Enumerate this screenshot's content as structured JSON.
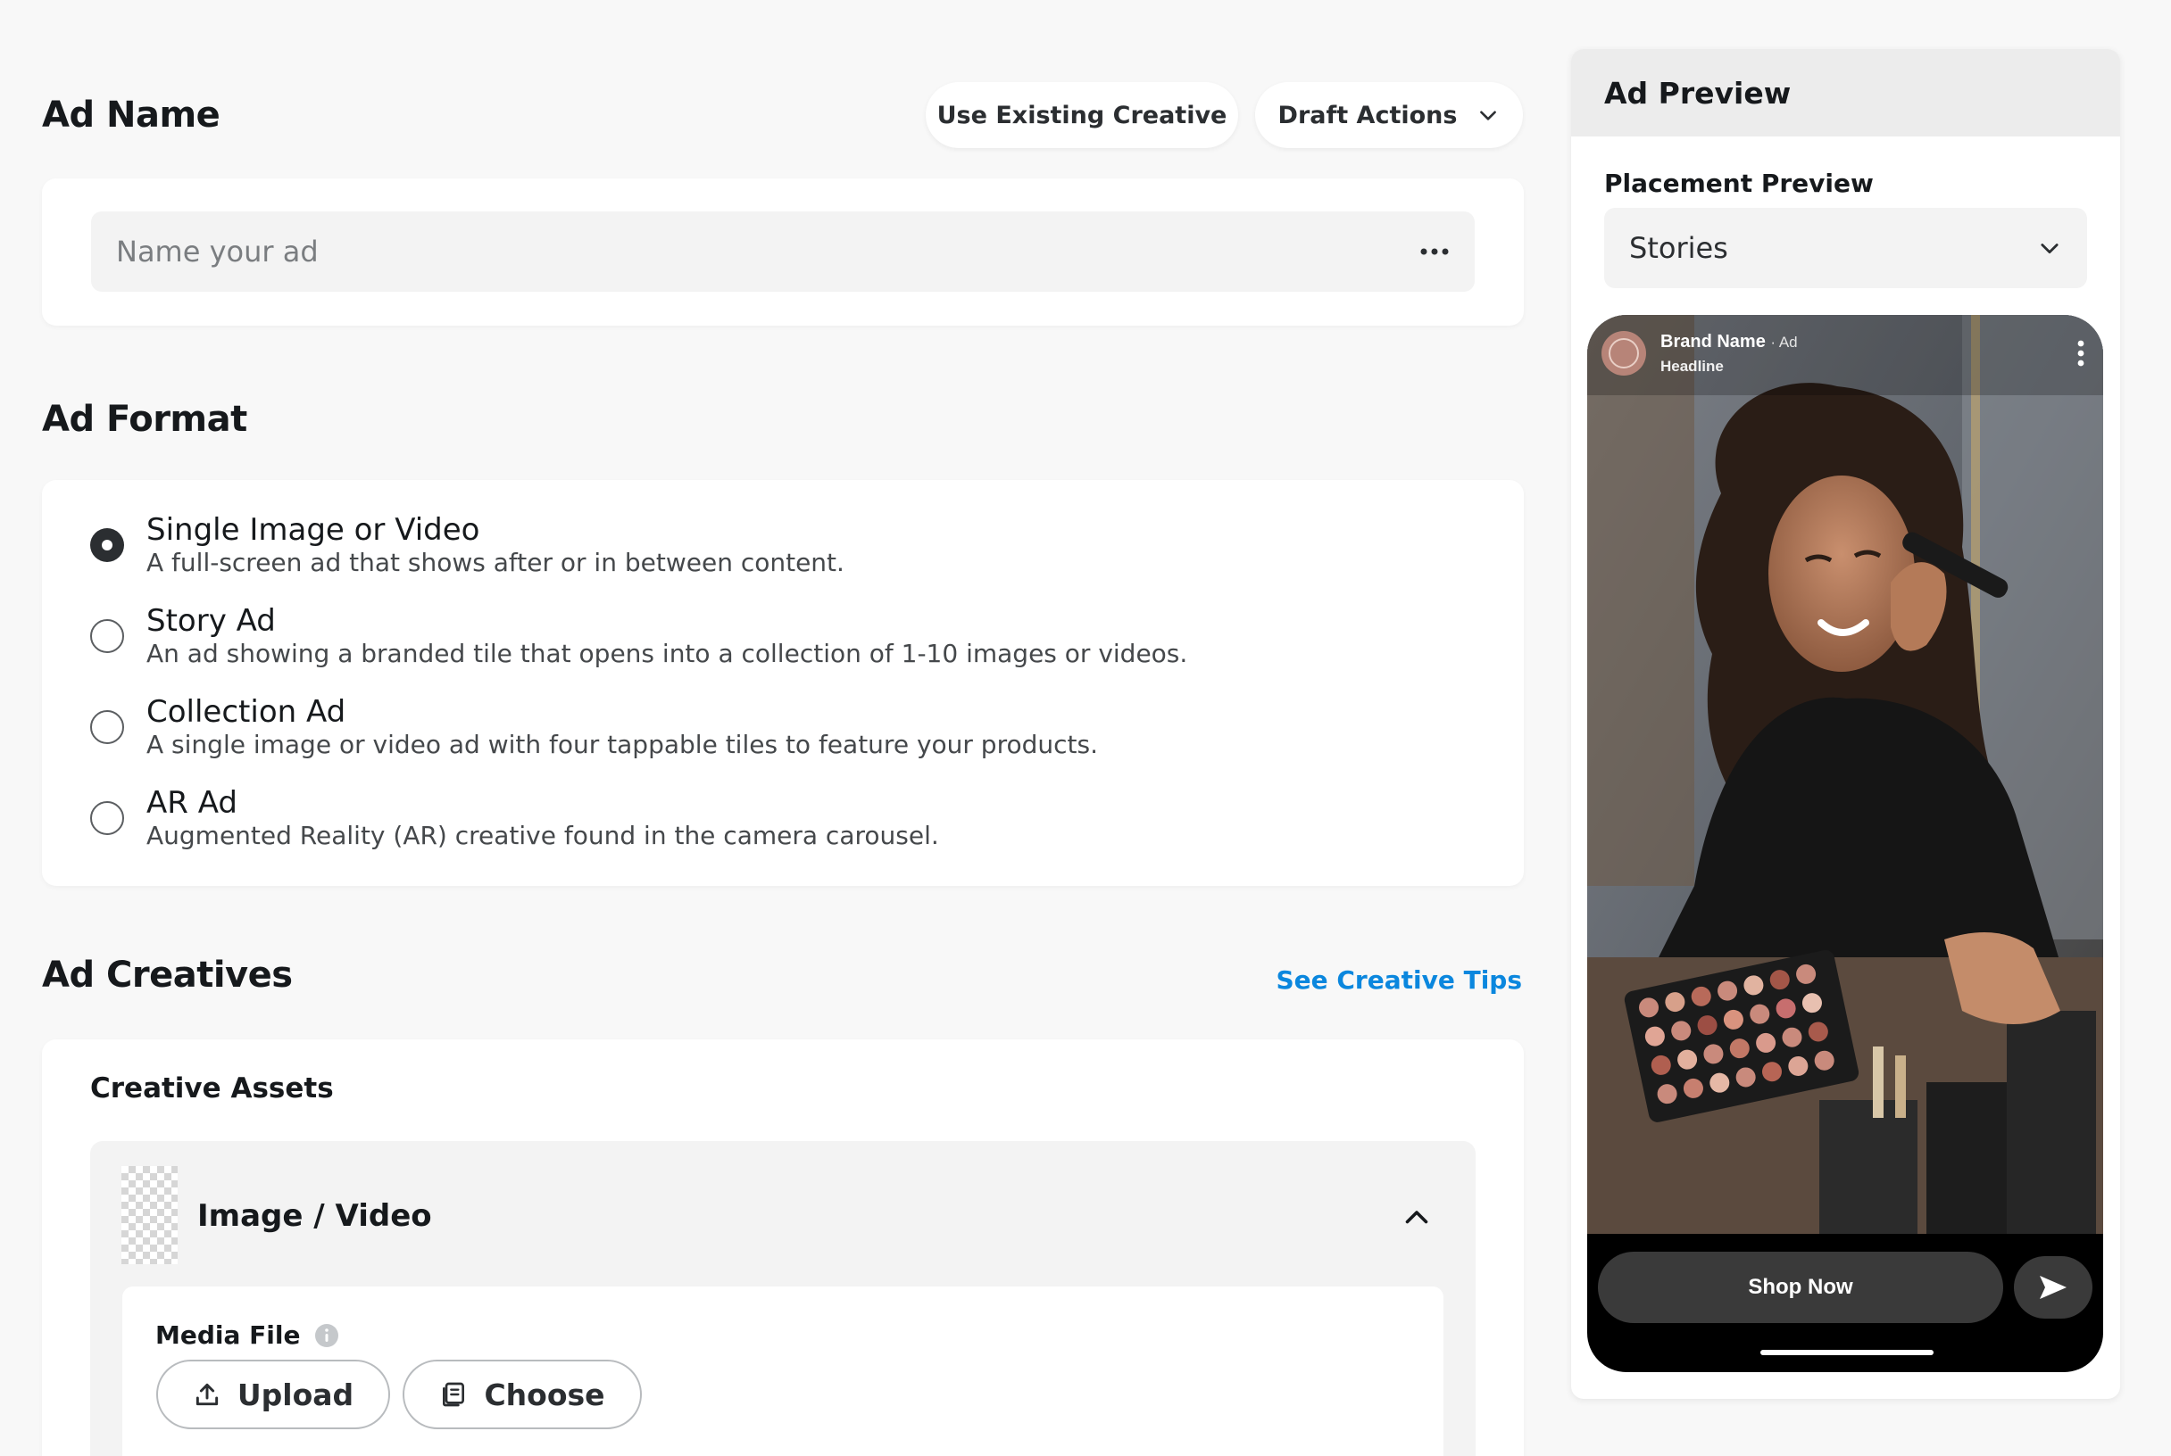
{
  "ad_name": {
    "heading": "Ad Name",
    "use_existing_label": "Use Existing Creative",
    "draft_actions_label": "Draft Actions",
    "input_placeholder": "Name your ad",
    "input_value": ""
  },
  "ad_format": {
    "heading": "Ad Format",
    "selected_index": 0,
    "options": [
      {
        "title": "Single Image or Video",
        "desc": "A full-screen ad that shows after or in between content."
      },
      {
        "title": "Story Ad",
        "desc": "An ad showing a branded tile that opens into a collection of 1-10 images or videos."
      },
      {
        "title": "Collection Ad",
        "desc": "A single image or video ad with four tappable tiles to feature your products."
      },
      {
        "title": "AR Ad",
        "desc": "Augmented Reality (AR) creative found in the camera carousel."
      }
    ]
  },
  "ad_creatives": {
    "heading": "Ad Creatives",
    "tips_link": "See Creative Tips",
    "assets_title": "Creative Assets",
    "image_video_label": "Image / Video",
    "media_file_label": "Media File",
    "upload_label": "Upload",
    "choose_label": "Choose"
  },
  "preview": {
    "title": "Ad Preview",
    "placement_label": "Placement Preview",
    "placement_value": "Stories",
    "brand_name": "Brand Name",
    "ad_tag": "· Ad",
    "headline": "Headline",
    "cta_label": "Shop Now"
  },
  "colors": {
    "accent_link": "#0b87de",
    "page_bg": "#f8f8f8",
    "cta_bg": "#3a3a3a"
  },
  "icons": [
    "ellipsis-icon",
    "chevron-down-icon",
    "chevron-up-icon",
    "info-icon",
    "upload-icon",
    "choose-media-icon",
    "send-icon",
    "more-vertical-icon"
  ]
}
